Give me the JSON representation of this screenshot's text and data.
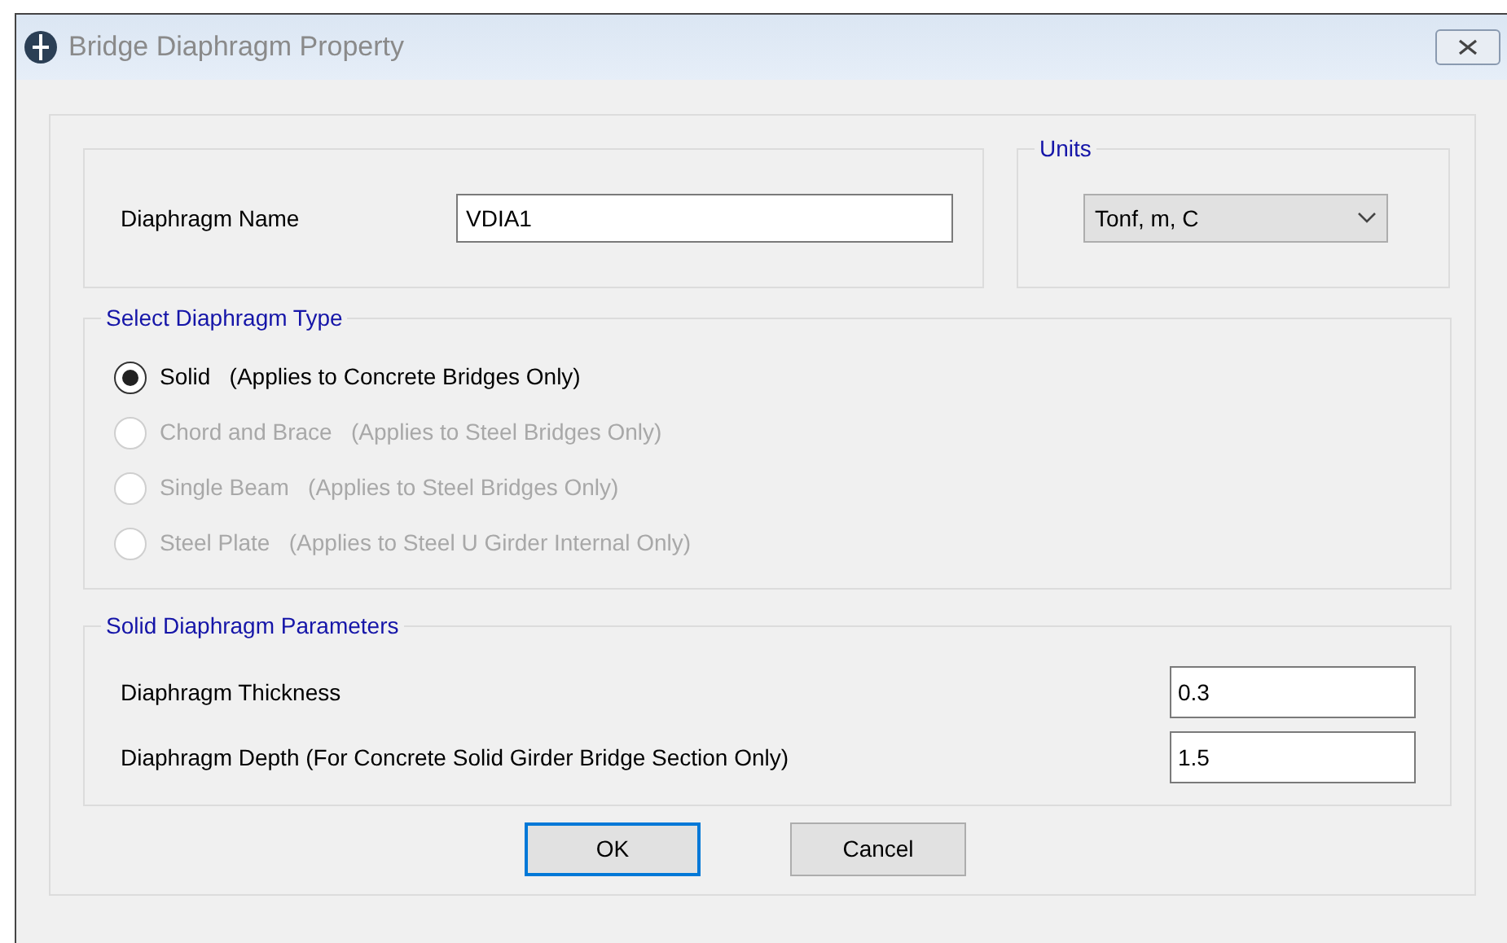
{
  "window": {
    "title": "Bridge Diaphragm Property"
  },
  "name_group": {
    "label": "Diaphragm Name",
    "value": "VDIA1"
  },
  "units": {
    "title": "Units",
    "value": "Tonf, m, C"
  },
  "type_group": {
    "title": "Select Diaphragm Type",
    "options": [
      {
        "label": "Solid",
        "note": "(Applies to Concrete Bridges Only)",
        "selected": true,
        "disabled": false
      },
      {
        "label": "Chord and Brace",
        "note": "(Applies to Steel Bridges Only)",
        "selected": false,
        "disabled": true
      },
      {
        "label": "Single Beam",
        "note": "(Applies to Steel Bridges Only)",
        "selected": false,
        "disabled": true
      },
      {
        "label": "Steel Plate",
        "note": "(Applies to Steel U Girder Internal Only)",
        "selected": false,
        "disabled": true
      }
    ]
  },
  "params": {
    "title": "Solid Diaphragm Parameters",
    "fields": [
      {
        "label": "Diaphragm Thickness",
        "value": "0.3"
      },
      {
        "label": "Diaphragm Depth (For Concrete Solid Girder Bridge Section Only)",
        "value": "1.5"
      }
    ]
  },
  "buttons": [
    {
      "label": "OK",
      "default": true
    },
    {
      "label": "Cancel",
      "default": false
    }
  ]
}
